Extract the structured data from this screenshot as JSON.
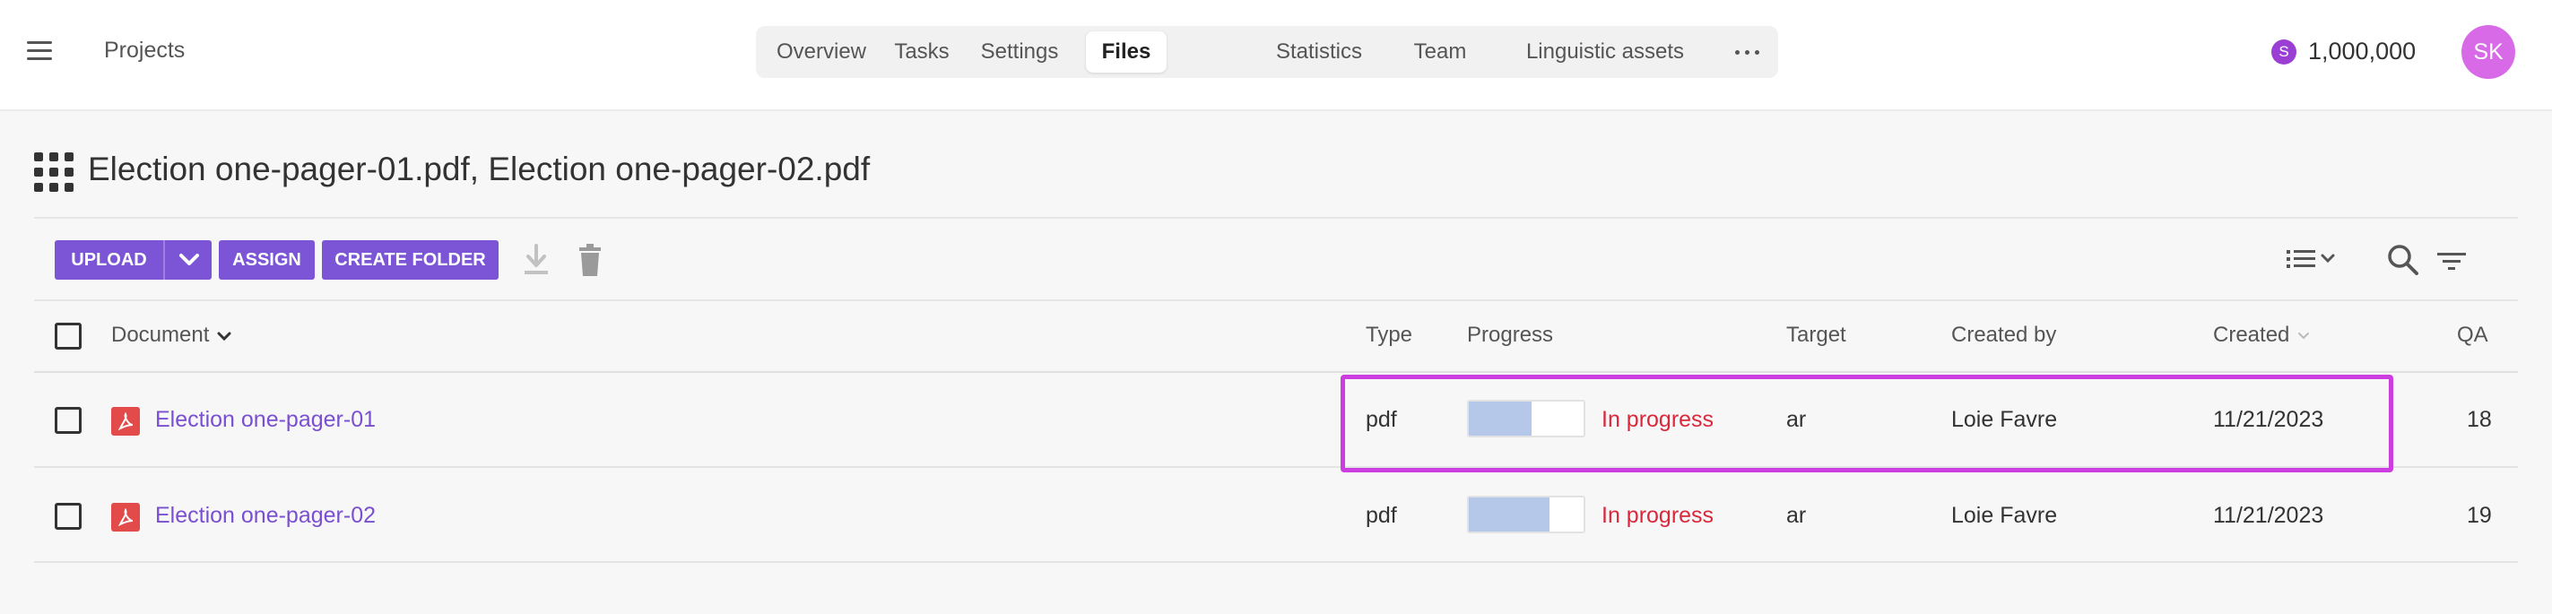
{
  "header": {
    "projects_label": "Projects",
    "nav_tabs": [
      {
        "label": "Overview",
        "active": false
      },
      {
        "label": "Tasks",
        "active": false
      },
      {
        "label": "Settings",
        "active": false
      },
      {
        "label": "Files",
        "active": true
      },
      {
        "label": "Statistics",
        "active": false
      },
      {
        "label": "Team",
        "active": false
      },
      {
        "label": "Linguistic assets",
        "active": false
      }
    ],
    "credits_symbol": "S",
    "credits": "1,000,000",
    "avatar_initials": "SK"
  },
  "page": {
    "title": "Election one-pager-01.pdf, Election one-pager-02.pdf"
  },
  "toolbar": {
    "upload_label": "UPLOAD",
    "assign_label": "ASSIGN",
    "create_folder_label": "CREATE FOLDER"
  },
  "table": {
    "columns": {
      "document": "Document",
      "type": "Type",
      "progress": "Progress",
      "target": "Target",
      "created_by": "Created by",
      "created": "Created",
      "qa": "QA"
    },
    "rows": [
      {
        "document": "Election one-pager-01",
        "type": "pdf",
        "progress_fraction": 0.55,
        "status": "In progress",
        "target": "ar",
        "created_by": "Loie Favre",
        "created": "11/21/2023",
        "qa": "18"
      },
      {
        "document": "Election one-pager-02",
        "type": "pdf",
        "progress_fraction": 0.7,
        "status": "In progress",
        "target": "ar",
        "created_by": "Loie Favre",
        "created": "11/21/2023",
        "qa": "19"
      }
    ]
  },
  "colors": {
    "accent": "#7b55d6",
    "status_in_progress": "#d9283c",
    "highlight": "#cc3ee0",
    "progress_fill": "#b6c8ea"
  }
}
